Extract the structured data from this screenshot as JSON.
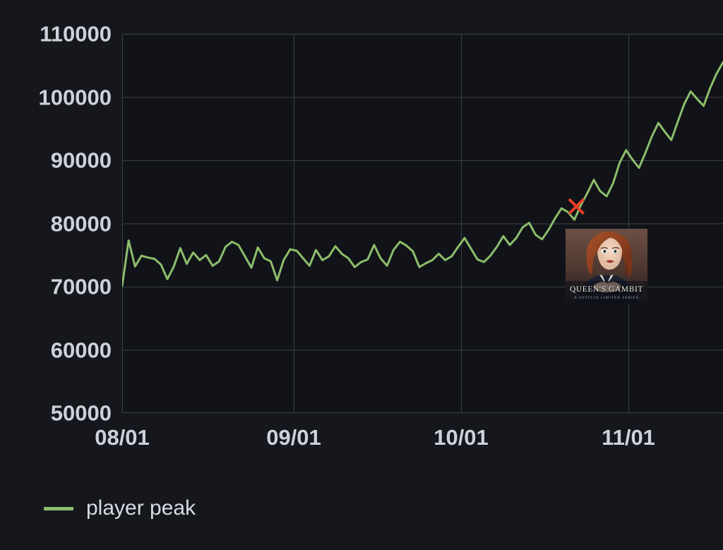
{
  "chart_data": {
    "type": "line",
    "title": "",
    "xlabel": "",
    "ylabel": "",
    "grid": true,
    "legend_position": "bottom-left",
    "ylim": [
      50000,
      110000
    ],
    "yticks": [
      110000,
      100000,
      90000,
      80000,
      70000,
      60000,
      50000
    ],
    "ytick_labels": [
      "110000",
      "100000",
      "90000",
      "80000",
      "70000",
      "60000",
      "50000"
    ],
    "xticks": [
      "08/01",
      "09/01",
      "10/01",
      "11/01"
    ],
    "xtick_labels": [
      "08/01",
      "09/01",
      "10/01",
      "11/01"
    ],
    "xlim": [
      "07/31",
      "11/22"
    ],
    "series": [
      {
        "name": "player peak",
        "color": "#8cbd6c",
        "values": [
          70100,
          77300,
          73200,
          74900,
          74600,
          74400,
          73500,
          71200,
          73200,
          76100,
          73600,
          75400,
          74200,
          75000,
          73300,
          74000,
          76300,
          77100,
          76600,
          74800,
          73000,
          76200,
          74500,
          74000,
          71000,
          74200,
          75900,
          75700,
          74500,
          73300,
          75800,
          74200,
          74800,
          76400,
          75200,
          74500,
          73100,
          73900,
          74300,
          76600,
          74500,
          73300,
          75800,
          77100,
          76500,
          75600,
          73100,
          73700,
          74200,
          75200,
          74200,
          74800,
          76300,
          77700,
          76000,
          74300,
          73900,
          74900,
          76300,
          78000,
          76600,
          77700,
          79400,
          80100,
          78200,
          77500,
          79000,
          80800,
          82400,
          81800,
          80600,
          82900,
          84800,
          86900,
          85100,
          84300,
          86400,
          89600,
          91600,
          90100,
          88800,
          91200,
          93800,
          95900,
          94500,
          93200,
          96100,
          98900,
          100900,
          99700,
          98600,
          101400,
          103700,
          105500
        ]
      }
    ],
    "annotations": [
      {
        "name": "release-marker",
        "label": "✕",
        "color": "#ea4026",
        "x_frac": 0.756,
        "value": 82500
      },
      {
        "name": "queens-gambit-poster",
        "title": "QUEEN'S GAMBIT",
        "subtitle": "A NETFLIX LIMITED SERIES"
      }
    ]
  },
  "axes": {
    "y_labels": [
      "110000",
      "100000",
      "90000",
      "80000",
      "70000",
      "60000",
      "50000"
    ],
    "x_labels": [
      "08/01",
      "09/01",
      "10/01",
      "11/01"
    ]
  },
  "legend": {
    "entries": [
      {
        "label": "player peak",
        "color": "#8cbd6c"
      }
    ]
  },
  "poster": {
    "title": "QUEEN'S GAMBIT",
    "subtitle": "A NETFLIX LIMITED SERIES"
  },
  "colors": {
    "background": "#15171c",
    "plot_background": "#111318",
    "grid": "#3b4048",
    "series": "#8cbd6c",
    "marker": "#ea4026",
    "text": "#ccd2dc"
  }
}
